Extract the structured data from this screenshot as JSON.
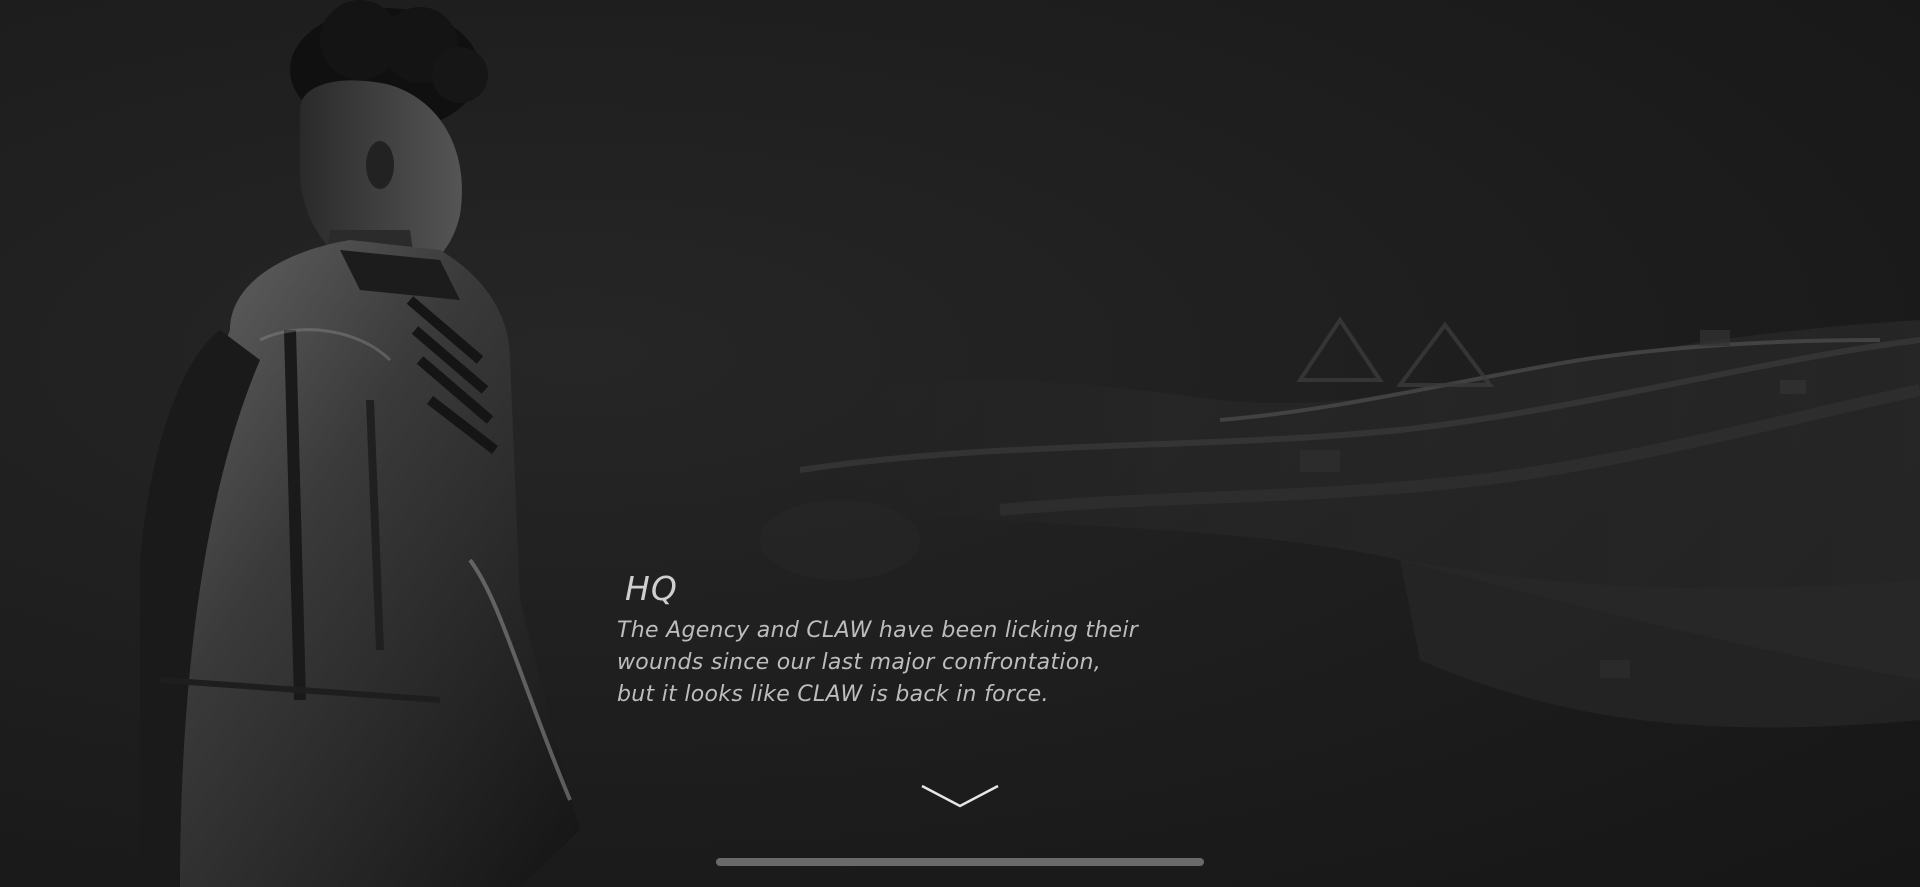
{
  "dialog": {
    "speaker": "HQ",
    "lines": [
      "The Agency and CLAW have been licking their",
      "wounds since our last major confrontation,",
      "but it looks like CLAW is back in force."
    ]
  },
  "icons": {
    "advance": "chevron-down-icon"
  },
  "colors": {
    "background": "#1e1e1e",
    "text": "#bdbdbd",
    "speaker": "#cfcfcf",
    "scrollbar": "#6a6a6a"
  }
}
